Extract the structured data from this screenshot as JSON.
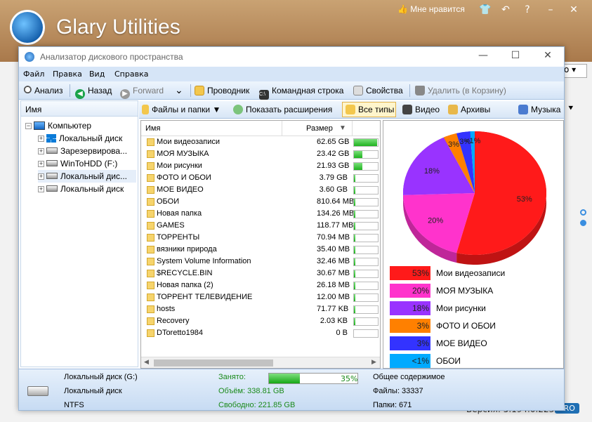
{
  "app": {
    "title": "Glary Utilities",
    "like_label": "Мне нравится",
    "combo_partial": "о",
    "version_text": "Версия: 5.194.0.223",
    "pro_badge": "PRO"
  },
  "dialog": {
    "title": "Анализатор дискового пространства",
    "menu": [
      "Файл",
      "Правка",
      "Вид",
      "Справка"
    ],
    "toolbar": {
      "analyze": "Анализ",
      "back": "Назад",
      "forward": "Forward",
      "explorer": "Проводник",
      "cmd": "Командная строка",
      "properties": "Свойства",
      "delete": "Удалить (в Корзину)"
    },
    "tree": {
      "header": "Имя",
      "root": "Компьютер",
      "drives": [
        "Локальный диск",
        "Зарезервирова...",
        "WinToHDD (F:)",
        "Локальный дис...",
        "Локальный диск"
      ]
    },
    "toolbar2": {
      "files_folders": "Файлы и папки",
      "show_ext": "Показать расширения",
      "all_types": "Все типы",
      "video": "Видео",
      "archives": "Архивы",
      "music": "Музыка"
    },
    "list": {
      "col_name": "Имя",
      "col_size": "Размер",
      "rows": [
        {
          "name": "Мои видеозаписи",
          "size": "62.65 GB",
          "pct": 0.97
        },
        {
          "name": "МОЯ МУЗЫКА",
          "size": "23.42 GB",
          "pct": 0.36
        },
        {
          "name": "Мои рисунки",
          "size": "21.93 GB",
          "pct": 0.34
        },
        {
          "name": "ФОТО И ОБОИ",
          "size": "3.79 GB",
          "pct": 0.06
        },
        {
          "name": "МОЕ ВИДЕО",
          "size": "3.60 GB",
          "pct": 0.06
        },
        {
          "name": "ОБОИ",
          "size": "810.64 MB",
          "pct": 0.02
        },
        {
          "name": "Новая папка",
          "size": "134.26 MB",
          "pct": 0.01
        },
        {
          "name": "GAMES",
          "size": "118.77 MB",
          "pct": 0.01
        },
        {
          "name": "ТОРРЕНТЫ",
          "size": "70.94 MB",
          "pct": 0.01
        },
        {
          "name": "вязники природа",
          "size": "35.40 MB",
          "pct": 0.01
        },
        {
          "name": "System Volume Information",
          "size": "32.46 MB",
          "pct": 0.01
        },
        {
          "name": "$RECYCLE.BIN",
          "size": "30.67 MB",
          "pct": 0.01
        },
        {
          "name": "Новая папка (2)",
          "size": "26.18 MB",
          "pct": 0.01
        },
        {
          "name": "ТОРРЕНТ ТЕЛЕВИДЕНИЕ",
          "size": "12.00 MB",
          "pct": 0.01
        },
        {
          "name": "hosts",
          "size": "71.77 KB",
          "pct": 0.01
        },
        {
          "name": "Recovery",
          "size": "2.03 KB",
          "pct": 0.01
        },
        {
          "name": "DToretto1984",
          "size": "0 B",
          "pct": 0.0
        }
      ]
    },
    "legend": [
      {
        "pct": "53%",
        "label": "Мои видеозаписи",
        "color": "#ff1a1a"
      },
      {
        "pct": "20%",
        "label": "МОЯ МУЗЫКА",
        "color": "#ff33cc"
      },
      {
        "pct": "18%",
        "label": "Мои рисунки",
        "color": "#9933ff"
      },
      {
        "pct": "3%",
        "label": "ФОТО И ОБОИ",
        "color": "#ff8000"
      },
      {
        "pct": "3%",
        "label": "МОЕ ВИДЕО",
        "color": "#3333ff"
      },
      {
        "pct": "<1%",
        "label": "ОБОИ",
        "color": "#00aaff"
      }
    ],
    "status": {
      "disk_name": "Локальный диск (G:)",
      "disk_type": "Локальный диск",
      "fs": "NTFS",
      "used_label": "Занято:",
      "used_pct": "35%",
      "used_fraction": 0.35,
      "volume": "Объём: 338.81 GB",
      "free": "Свободно: 221.85 GB",
      "total_label": "Общее содержимое",
      "files": "Файлы: 33337",
      "folders": "Папки: 671"
    }
  },
  "chart_data": {
    "type": "pie",
    "categories": [
      "Мои видеозаписи",
      "МОЯ МУЗЫКА",
      "Мои рисунки",
      "ФОТО И ОБОИ",
      "МОЕ ВИДЕО",
      "ОБОИ"
    ],
    "values": [
      53,
      20,
      18,
      3,
      3,
      1
    ],
    "labels": [
      "53%",
      "20%",
      "18%",
      "3%",
      "3%",
      "<1%"
    ],
    "colors": [
      "#ff1a1a",
      "#ff33cc",
      "#9933ff",
      "#ff8000",
      "#3333ff",
      "#00aaff"
    ]
  }
}
